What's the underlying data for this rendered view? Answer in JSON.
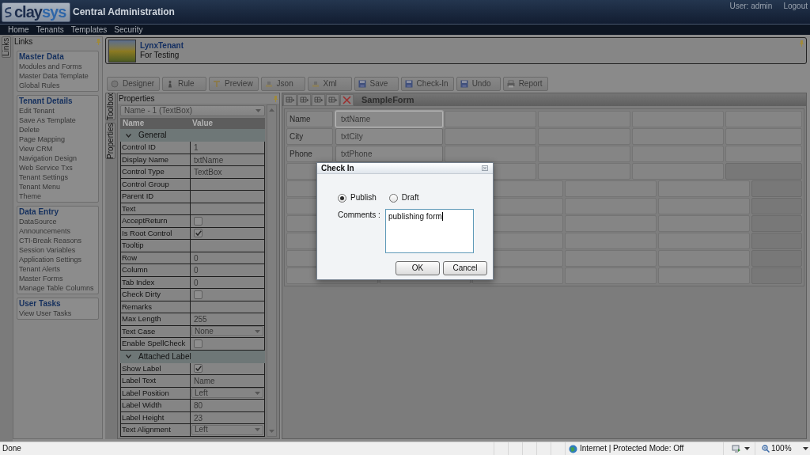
{
  "header": {
    "logo": {
      "part_1": "clay",
      "part_2": "sys"
    },
    "title": "Central Administration",
    "user": "User: admin",
    "logout": "Logout"
  },
  "nav": [
    "Home",
    "Tenants",
    "Templates",
    "Security"
  ],
  "links_tab": "Links",
  "links_panel": {
    "title": "Links",
    "groups": [
      {
        "title": "Master Data",
        "items": [
          "Modules and Forms",
          "Master Data Template",
          "Global Rules"
        ]
      },
      {
        "title": "Tenant Details",
        "items": [
          "Edit Tenant",
          "Save As Template",
          "Delete",
          "Page Mapping",
          "View CRM",
          "Navigation Design",
          "Web Service Txs",
          "Tenant Settings",
          "Tenant Menu",
          "Theme"
        ]
      },
      {
        "title": "Data Entry",
        "items": [
          "DataSource",
          "Announcements",
          "CTI-Break Reasons",
          "Session Variables",
          "Application Settings",
          "Tenant Alerts",
          "Master Forms",
          "Manage Table Columns"
        ]
      },
      {
        "title": "User Tasks",
        "items": [
          "View User Tasks"
        ]
      }
    ]
  },
  "tenant": {
    "name": "LynxTenant",
    "description": "For Testing"
  },
  "toolbar": [
    "Designer",
    "Rule",
    "Preview",
    "Json",
    "Xml",
    "Save",
    "Check-In",
    "Undo",
    "Report"
  ],
  "side_tabs": [
    "Toolbox",
    "Properties"
  ],
  "properties": {
    "title": "Properties",
    "selector": "Name - 1 (TextBox)",
    "columns": [
      "Name",
      "Value"
    ],
    "sections": [
      {
        "title": "General",
        "expanded": true,
        "rows": [
          {
            "name": "Control ID",
            "kind": "text",
            "value": "1"
          },
          {
            "name": "Display Name",
            "kind": "text",
            "value": "txtName"
          },
          {
            "name": "Control Type",
            "kind": "text",
            "value": "TextBox"
          },
          {
            "name": "Control Group",
            "kind": "text"
          },
          {
            "name": "Parent ID",
            "kind": "text"
          },
          {
            "name": "Text",
            "kind": "text"
          },
          {
            "name": "AcceptReturn",
            "kind": "checkbox",
            "checked": false
          },
          {
            "name": "Is Root Control",
            "kind": "checkbox",
            "checked": true
          },
          {
            "name": "Tooltip",
            "kind": "text"
          },
          {
            "name": "Row",
            "kind": "text",
            "value": "0"
          },
          {
            "name": "Column",
            "kind": "text",
            "value": "0"
          },
          {
            "name": "Tab Index",
            "kind": "text",
            "value": "0"
          },
          {
            "name": "Check Dirty",
            "kind": "checkbox",
            "checked": false
          },
          {
            "name": "Remarks",
            "kind": "text"
          },
          {
            "name": "Max Length",
            "kind": "text",
            "value": "255"
          },
          {
            "name": "Text Case",
            "kind": "dropdown",
            "value": "None"
          },
          {
            "name": "Enable SpellCheck",
            "kind": "checkbox",
            "checked": false
          }
        ]
      },
      {
        "title": "Attached Label",
        "expanded": true,
        "rows": [
          {
            "name": "Show Label",
            "kind": "checkbox",
            "checked": true
          },
          {
            "name": "Label Text",
            "kind": "text",
            "value": "Name"
          },
          {
            "name": "Label Position",
            "kind": "dropdown",
            "value": "Left"
          },
          {
            "name": "Label Width",
            "kind": "text",
            "value": "80"
          },
          {
            "name": "Label Height",
            "kind": "text",
            "value": "23"
          },
          {
            "name": "Text Alignment",
            "kind": "dropdown",
            "value": "Left"
          }
        ]
      }
    ]
  },
  "designer": {
    "title": "SampleForm",
    "fields": [
      {
        "label": "Name",
        "placeholder": "txtName",
        "selected": true
      },
      {
        "label": "City",
        "placeholder": "txtCity",
        "selected": false
      },
      {
        "label": "Phone",
        "placeholder": "txtPhone",
        "selected": false
      }
    ]
  },
  "dialog": {
    "title": "Check In",
    "options": [
      {
        "label": "Publish",
        "selected": true
      },
      {
        "label": "Draft",
        "selected": false
      }
    ],
    "comments_label": "Comments :",
    "comments": "publishing form",
    "buttons": [
      "OK",
      "Cancel"
    ]
  },
  "status_bar": {
    "text": "Done",
    "zone": "Internet | Protected Mode: Off",
    "zoom": "100%"
  }
}
